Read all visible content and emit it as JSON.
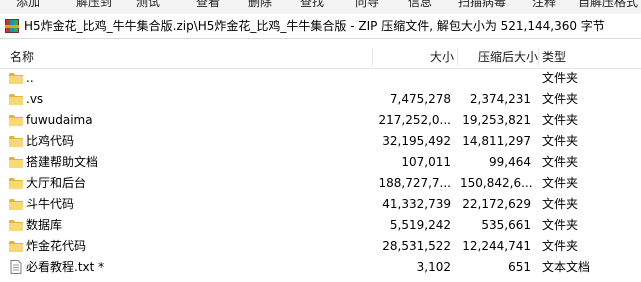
{
  "toolbar": {
    "partial_labels": [
      "添加",
      "解压到",
      "测试",
      "查看",
      "删除",
      "查找",
      "向导",
      "信息",
      "扫描病毒",
      "注释",
      "自解压格式"
    ]
  },
  "address_bar": {
    "icon": "zip-archive-icon",
    "text": "H5炸金花_比鸡_牛牛集合版.zip\\H5炸金花_比鸡_牛牛集合版 - ZIP 压缩文件, 解包大小为 521,144,360 字节"
  },
  "columns": {
    "name": "名称",
    "size": "大小",
    "packed": "压缩后大小",
    "type": "类型"
  },
  "rows": [
    {
      "name": "..",
      "size": "",
      "packed": "",
      "type": "文件夹",
      "icon": "folder-icon"
    },
    {
      "name": ".vs",
      "size": "7,475,278",
      "packed": "2,374,231",
      "type": "文件夹",
      "icon": "folder-icon"
    },
    {
      "name": "fuwudaima",
      "size": "217,252,0...",
      "packed": "19,253,821",
      "type": "文件夹",
      "icon": "folder-icon"
    },
    {
      "name": "比鸡代码",
      "size": "32,195,492",
      "packed": "14,811,297",
      "type": "文件夹",
      "icon": "folder-icon"
    },
    {
      "name": "搭建帮助文档",
      "size": "107,011",
      "packed": "99,464",
      "type": "文件夹",
      "icon": "folder-icon"
    },
    {
      "name": "大厅和后台",
      "size": "188,727,7...",
      "packed": "150,842,6...",
      "type": "文件夹",
      "icon": "folder-icon"
    },
    {
      "name": "斗牛代码",
      "size": "41,332,739",
      "packed": "22,172,629",
      "type": "文件夹",
      "icon": "folder-icon"
    },
    {
      "name": "数据库",
      "size": "5,519,242",
      "packed": "535,661",
      "type": "文件夹",
      "icon": "folder-icon"
    },
    {
      "name": "炸金花代码",
      "size": "28,531,522",
      "packed": "12,244,741",
      "type": "文件夹",
      "icon": "folder-icon"
    },
    {
      "name": "必看教程.txt *",
      "size": "3,102",
      "packed": "651",
      "type": "文本文档",
      "icon": "text-file-icon"
    }
  ],
  "colors": {
    "folder_yellow": "#f8d775",
    "folder_dark": "#e0b343"
  }
}
